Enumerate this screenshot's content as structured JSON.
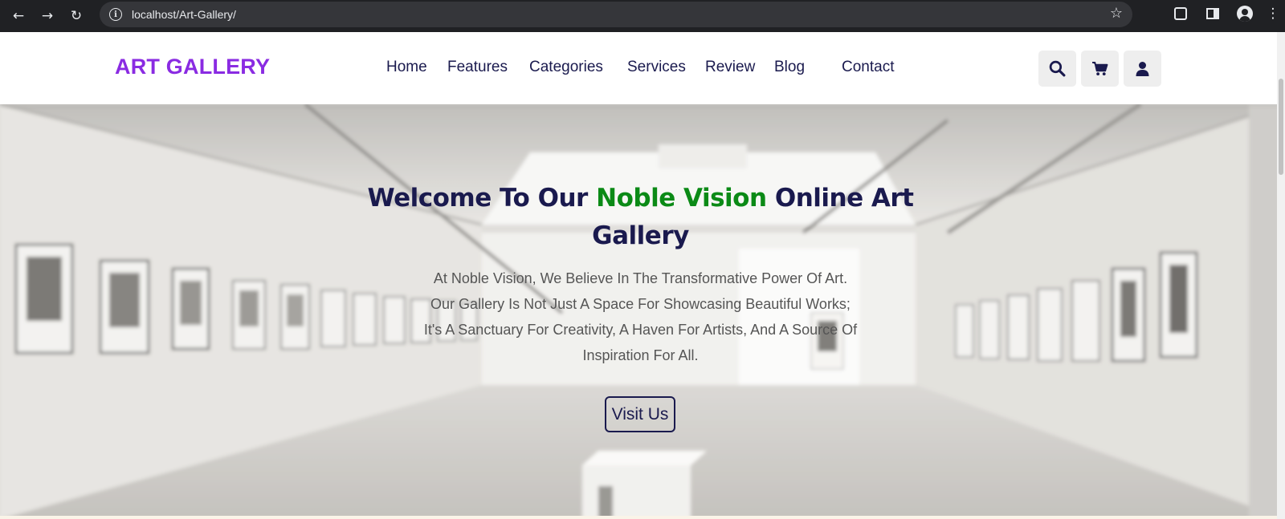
{
  "browser": {
    "url": "localhost/Art-Gallery/",
    "back_icon": "back-arrow-icon",
    "forward_icon": "forward-arrow-icon",
    "reload_icon": "reload-icon"
  },
  "site": {
    "logo": "ART GALLERY",
    "nav": [
      "Home",
      "Features",
      "Categories",
      "Services",
      "Review",
      "Blog",
      "Contact"
    ],
    "header_icons": [
      "search-icon",
      "cart-icon",
      "user-icon"
    ],
    "colors": {
      "brand": "#8a2be2",
      "accent": "#0b8a16",
      "navy": "#1a1a4e"
    }
  },
  "hero": {
    "title_pre": "Welcome To Our ",
    "title_accent": "Noble Vision",
    "title_post": " Online Art Gallery",
    "lines": [
      "At Noble Vision, We Believe In The Transformative Power Of Art.",
      "Our Gallery Is Not Just A Space For Showcasing Beautiful Works;",
      "It's A Sanctuary For Creativity, A Haven For Artists, And A Source Of",
      "Inspiration For All."
    ],
    "button": "Visit Us"
  }
}
